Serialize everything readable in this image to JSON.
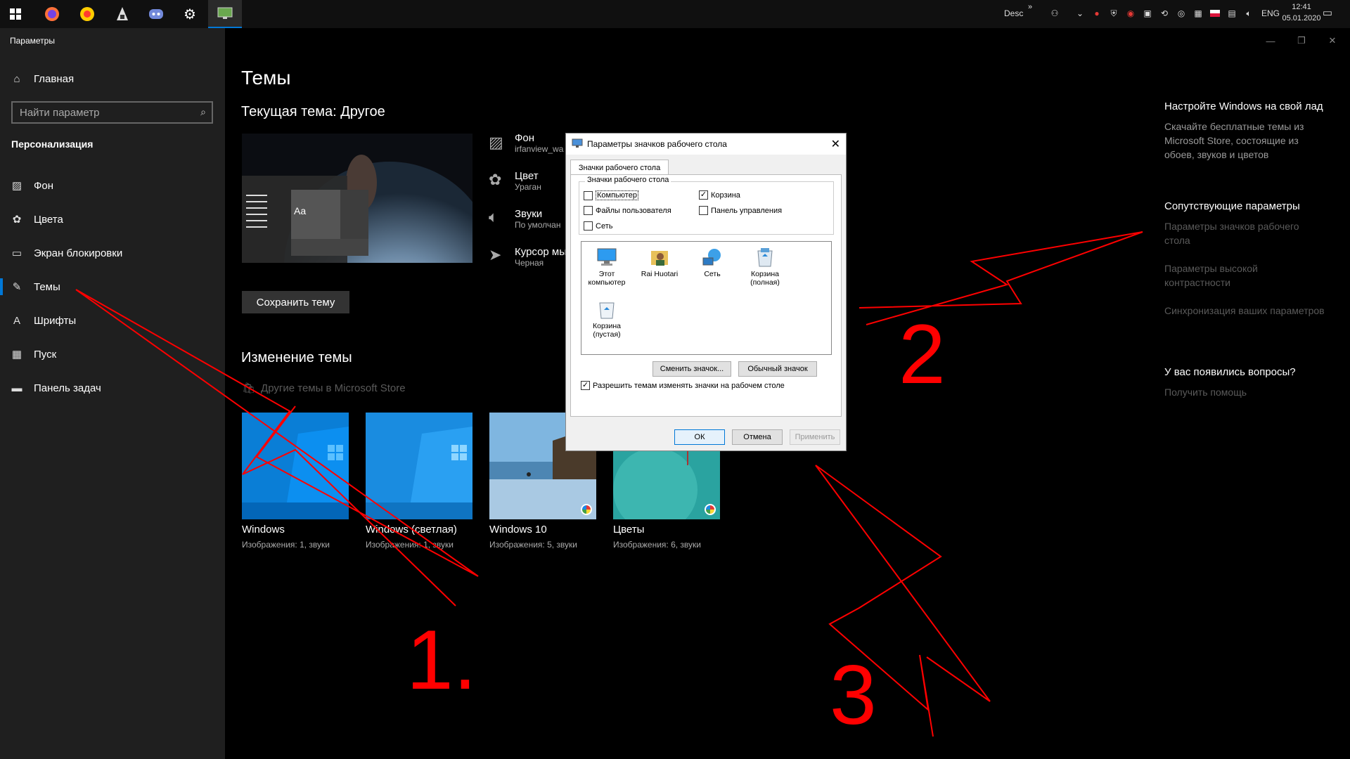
{
  "taskbar": {
    "icons": [
      "windows-start-icon",
      "firefox-icon",
      "yandex-icon",
      "notepad-icon",
      "discord-icon",
      "settings-gear-icon",
      "monitor-app-icon"
    ],
    "desc_label": "Desc",
    "language": "ENG",
    "time": "12:41",
    "date": "05.01.2020"
  },
  "window": {
    "app_title": "Параметры",
    "minimize": "—",
    "restore": "❐",
    "close": "✕"
  },
  "sidebar": {
    "home_label": "Главная",
    "search_placeholder": "Найти параметр",
    "section_title": "Персонализация",
    "items": [
      {
        "label": "Фон",
        "icon": "picture-icon"
      },
      {
        "label": "Цвета",
        "icon": "palette-icon"
      },
      {
        "label": "Экран блокировки",
        "icon": "lock-screen-icon"
      },
      {
        "label": "Темы",
        "icon": "themes-icon"
      },
      {
        "label": "Шрифты",
        "icon": "fonts-icon"
      },
      {
        "label": "Пуск",
        "icon": "start-icon"
      },
      {
        "label": "Панель задач",
        "icon": "taskbar-icon"
      }
    ]
  },
  "main": {
    "title": "Темы",
    "current_theme": "Текущая тема: Другое",
    "preview_aa": "Aa",
    "options": [
      {
        "title": "Фон",
        "sub": "irfanview_wa"
      },
      {
        "title": "Цвет",
        "sub": "Ураган"
      },
      {
        "title": "Звуки",
        "sub": "По умолчан"
      },
      {
        "title": "Курсор мы",
        "sub": "Черная"
      }
    ],
    "save_button": "Сохранить тему",
    "change_theme": "Изменение темы",
    "store_link": "Другие темы в Microsoft Store",
    "themes": [
      {
        "name": "Windows",
        "sub": "Изображения: 1, звуки"
      },
      {
        "name": "Windows (светлая)",
        "sub": "Изображения: 1, звуки"
      },
      {
        "name": "Windows 10",
        "sub": "Изображения: 5, звуки"
      },
      {
        "name": "Цветы",
        "sub": "Изображения: 6, звуки"
      }
    ]
  },
  "right": {
    "customize_title": "Настройте Windows на свой лад",
    "customize_text": "Скачайте бесплатные темы из Microsoft Store, состоящие из обоев, звуков и цветов",
    "related_title": "Сопутствующие параметры",
    "related_links": [
      "Параметры значков рабочего стола",
      "Параметры высокой контрастности",
      "Синхронизация ваших параметров"
    ],
    "questions_title": "У вас появились вопросы?",
    "help_link": "Получить помощь"
  },
  "dialog": {
    "title": "Параметры значков рабочего стола",
    "tab": "Значки рабочего стола",
    "group_label": "Значки рабочего стола",
    "checkboxes": [
      {
        "label": "Компьютер",
        "checked": false
      },
      {
        "label": "Корзина",
        "checked": true
      },
      {
        "label": "Файлы пользователя",
        "checked": false
      },
      {
        "label": "Панель управления",
        "checked": false
      },
      {
        "label": "Сеть",
        "checked": false
      }
    ],
    "icons": [
      {
        "label": "Этот компьютер",
        "icon": "computer-icon"
      },
      {
        "label": "Rai Huotari",
        "icon": "user-folder-icon"
      },
      {
        "label": "Сеть",
        "icon": "network-icon"
      },
      {
        "label": "Корзина (полная)",
        "icon": "recycle-bin-full-icon"
      },
      {
        "label": "Корзина (пустая)",
        "icon": "recycle-bin-empty-icon"
      }
    ],
    "change_icon_button": "Сменить значок...",
    "default_icon_button": "Обычный значок",
    "allow_themes_label": "Разрешить темам изменять значки на рабочем столе",
    "allow_themes_checked": true,
    "ok_button": "ОК",
    "cancel_button": "Отмена",
    "apply_button": "Применить"
  },
  "annotations": {
    "num1": "1.",
    "num2": "2",
    "num3": "3",
    "color": "#ff0000"
  }
}
